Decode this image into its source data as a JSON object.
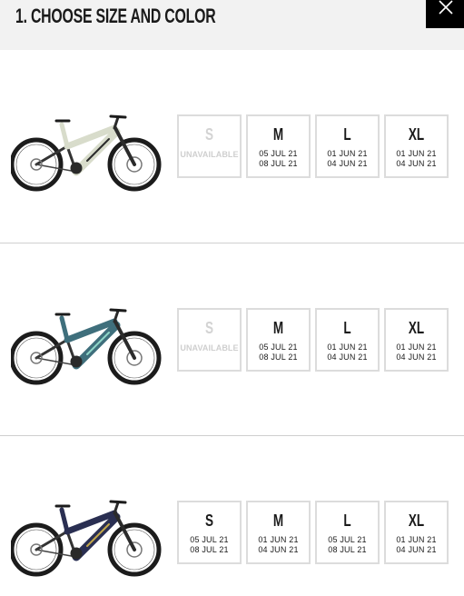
{
  "header": {
    "title": "1. CHOOSE SIZE AND COLOR",
    "close_icon": "close-icon"
  },
  "colors": {
    "header_bg": "#f2f2f2",
    "close_bg": "#000000",
    "border": "#dcdcdc",
    "unavailable_text": "#cfcfcf"
  },
  "options": [
    {
      "color_name": "",
      "frame_color": "#d8dccb",
      "accent_color": "#2b2b2b",
      "sizes": [
        {
          "size": "S",
          "available": false,
          "status": "UNAVAILABLE",
          "date1": "",
          "date2": ""
        },
        {
          "size": "M",
          "available": true,
          "status": "",
          "date1": "05 JUL 21",
          "date2": "08 JUL 21"
        },
        {
          "size": "L",
          "available": true,
          "status": "",
          "date1": "01 JUN 21",
          "date2": "04 JUN 21"
        },
        {
          "size": "XL",
          "available": true,
          "status": "",
          "date1": "01 JUN 21",
          "date2": "04 JUN 21"
        }
      ]
    },
    {
      "color_name": "",
      "frame_color": "#3f6f7c",
      "accent_color": "#8fd6c8",
      "sizes": [
        {
          "size": "S",
          "available": false,
          "status": "UNAVAILABLE",
          "date1": "",
          "date2": ""
        },
        {
          "size": "M",
          "available": true,
          "status": "",
          "date1": "05 JUL 21",
          "date2": "08 JUL 21"
        },
        {
          "size": "L",
          "available": true,
          "status": "",
          "date1": "01 JUN 21",
          "date2": "04 JUN 21"
        },
        {
          "size": "XL",
          "available": true,
          "status": "",
          "date1": "01 JUN 21",
          "date2": "04 JUN 21"
        }
      ]
    },
    {
      "color_name": "",
      "frame_color": "#2a2f52",
      "accent_color": "#c2a64a",
      "sizes": [
        {
          "size": "S",
          "available": true,
          "status": "",
          "date1": "05 JUL 21",
          "date2": "08 JUL 21"
        },
        {
          "size": "M",
          "available": true,
          "status": "",
          "date1": "01 JUN 21",
          "date2": "04 JUN 21"
        },
        {
          "size": "L",
          "available": true,
          "status": "",
          "date1": "05 JUL 21",
          "date2": "08 JUL 21"
        },
        {
          "size": "XL",
          "available": true,
          "status": "",
          "date1": "01 JUN 21",
          "date2": "04 JUN 21"
        }
      ]
    }
  ]
}
